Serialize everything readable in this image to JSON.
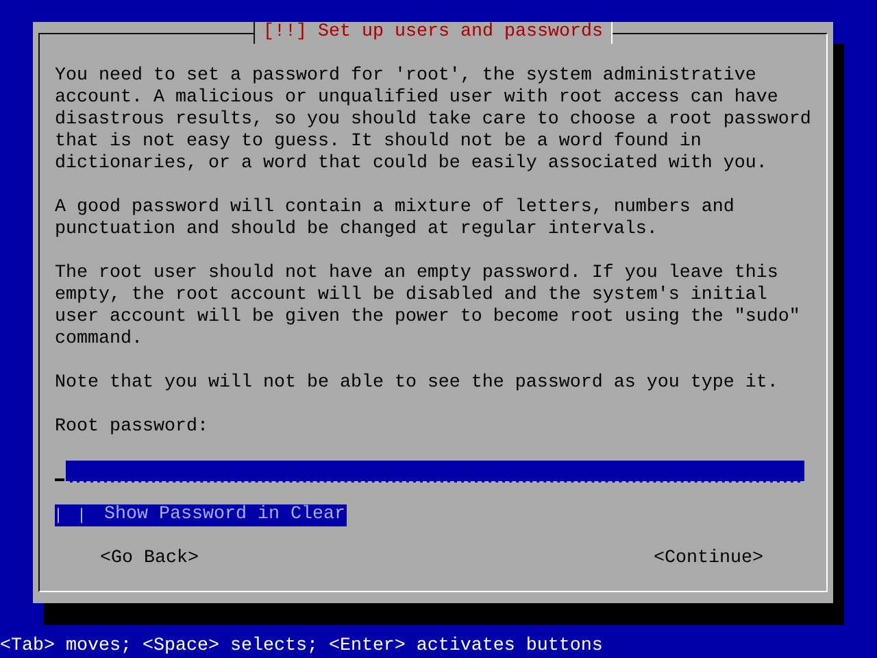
{
  "dialog": {
    "title": "[!!] Set up users and passwords",
    "paragraphs": [
      "You need to set a password for 'root', the system administrative\naccount. A malicious or unqualified user with root access can have\ndisastrous results, so you should take care to choose a root password\nthat is not easy to guess. It should not be a word found in\ndictionaries, or a word that could be easily associated with you.",
      "A good password will contain a mixture of letters, numbers and\npunctuation and should be changed at regular intervals.",
      "The root user should not have an empty password. If you leave this\nempty, the root account will be disabled and the system's initial\nuser account will be given the power to become root using the \"sudo\"\ncommand.",
      "Note that you will not be able to see the password as you type it."
    ],
    "field_label": "Root password:",
    "checkbox": {
      "label": "Show Password in Clear",
      "checked": false,
      "focused": true
    },
    "buttons": [
      {
        "label": "<Go Back>"
      },
      {
        "label": "<Continue>"
      }
    ]
  },
  "status_bar": "<Tab> moves; <Space> selects; <Enter> activates buttons"
}
